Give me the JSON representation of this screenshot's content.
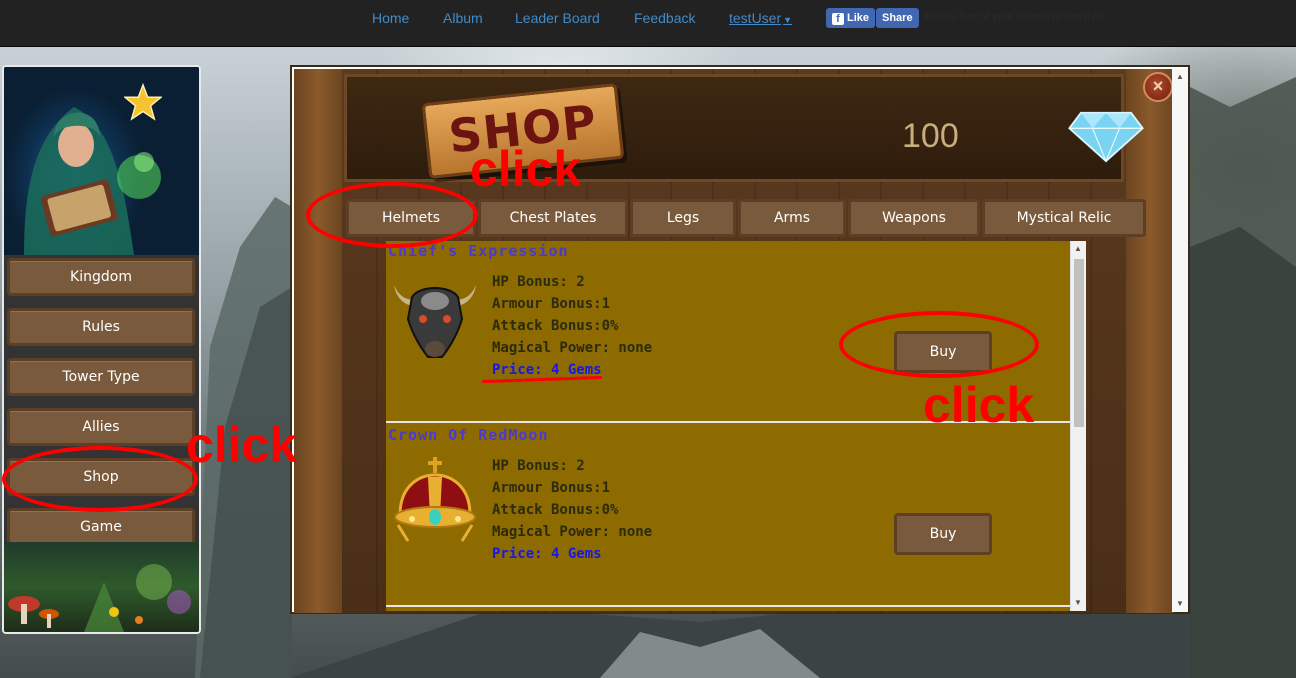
{
  "nav": {
    "items": [
      "Home",
      "Album",
      "Leader Board",
      "Feedback"
    ],
    "user": "testUser",
    "fb_like": "Like",
    "fb_share": "Share",
    "fb_social_text": "Be the first of your friends to like this."
  },
  "sidebar": {
    "items": [
      "Kingdom",
      "Rules",
      "Tower Type",
      "Allies",
      "Shop",
      "Game"
    ]
  },
  "shop": {
    "title": "SHOP",
    "gem_count": "100",
    "close": "×",
    "tabs": [
      "Helmets",
      "Chest Plates",
      "Legs",
      "Arms",
      "Weapons",
      "Mystical Relic"
    ],
    "items": [
      {
        "name": "Chief's Expression",
        "hp": "HP Bonus: 2",
        "armour": "Armour Bonus:1",
        "attack": "Attack Bonus:0%",
        "magic": "Magical Power: none",
        "price": "Price: 4 Gems",
        "buy": "Buy",
        "icon": "bull-helmet-icon"
      },
      {
        "name": "Crown Of RedMoon",
        "hp": "HP Bonus: 2",
        "armour": "Armour Bonus:1",
        "attack": "Attack Bonus:0%",
        "magic": "Magical Power: none",
        "price": "Price: 4 Gems",
        "buy": "Buy",
        "icon": "crown-icon"
      }
    ]
  },
  "annotations": {
    "click": "click"
  },
  "colors": {
    "nav_link": "#428bca",
    "button_bg": "#7a5a3c",
    "item_bg": "#8d6b00",
    "price": "#1818e0",
    "annotation": "#ff0000"
  }
}
